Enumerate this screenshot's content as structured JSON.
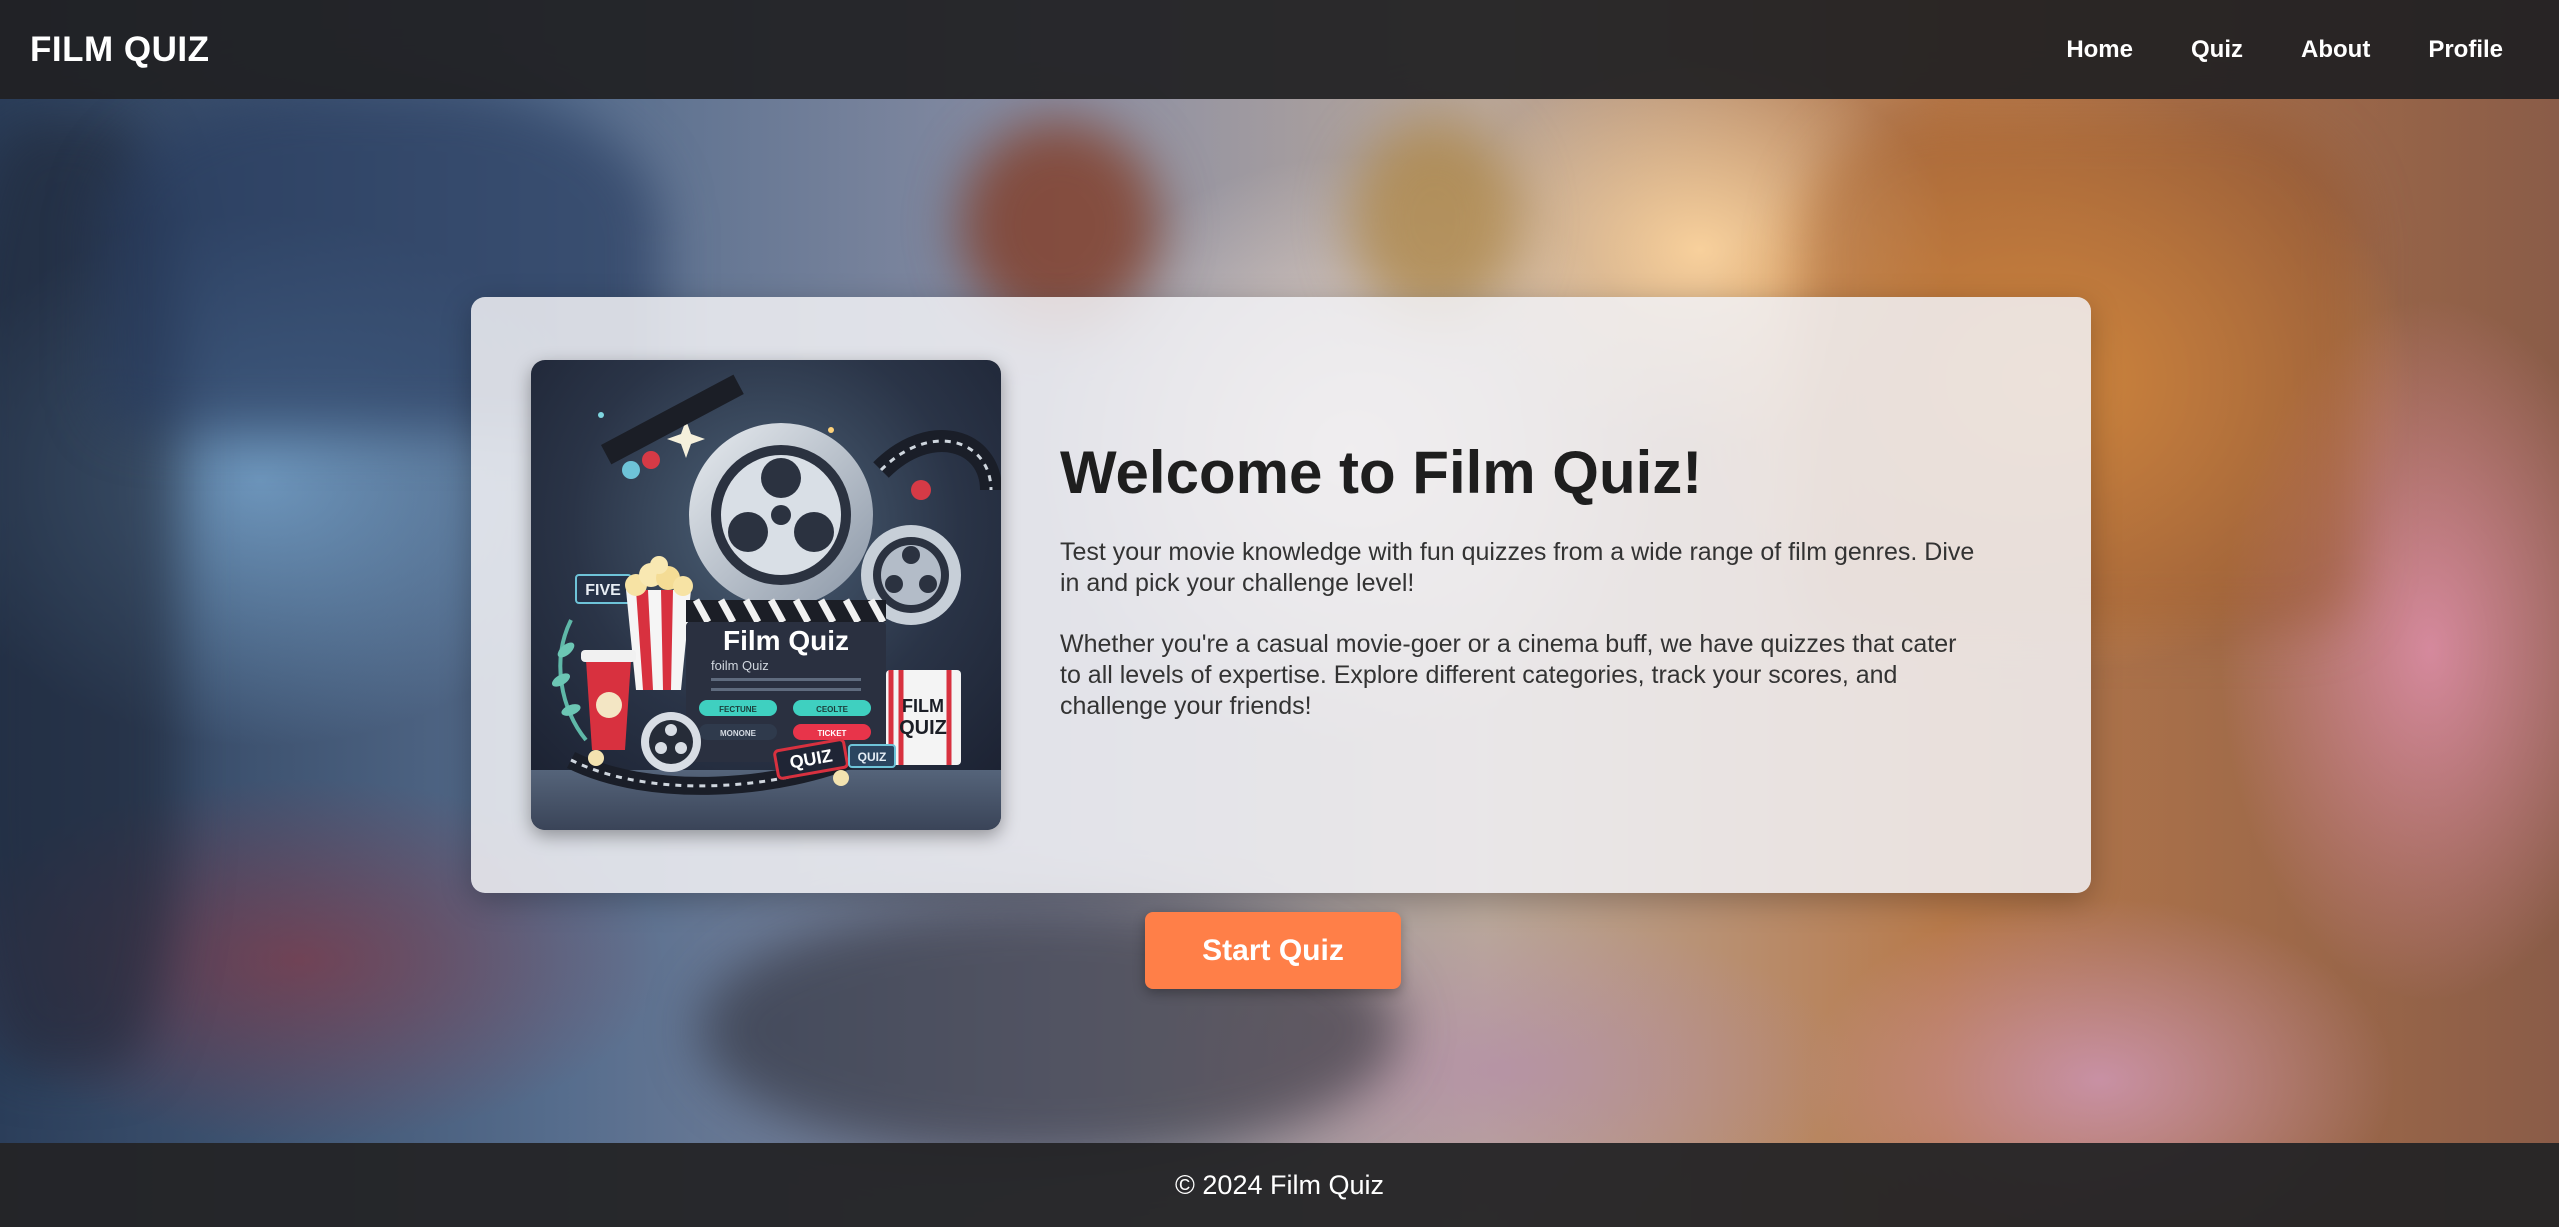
{
  "header": {
    "brand": "FILM QUIZ",
    "nav": [
      {
        "label": "Home"
      },
      {
        "label": "Quiz"
      },
      {
        "label": "About"
      },
      {
        "label": "Profile"
      }
    ]
  },
  "hero": {
    "image_labels": {
      "title": "Film Quiz",
      "subtitle": "foilm Quiz",
      "five": "FIVE",
      "quiz_ticket": "QUIZ",
      "quiz_small": "QUIZ",
      "box_line1": "FILM",
      "box_line2": "QUIZ",
      "btn1": "FECTUNE",
      "btn2": "CEOLTE",
      "btn3": "MONONE",
      "btn4": "TICKET"
    },
    "title": "Welcome to Film Quiz!",
    "paragraphs": [
      "Test your movie knowledge with fun quizzes from a wide range of film genres. Dive in and pick your challenge level!",
      "Whether you're a casual movie-goer or a cinema buff, we have quizzes that cater to all levels of expertise. Explore different categories, track your scores, and challenge your friends!"
    ]
  },
  "cta": {
    "label": "Start Quiz"
  },
  "footer": {
    "text": "© 2024 Film Quiz"
  },
  "colors": {
    "accent": "#ff7f48",
    "header_bg": "#202022",
    "card_bg": "#f1f1f4"
  }
}
